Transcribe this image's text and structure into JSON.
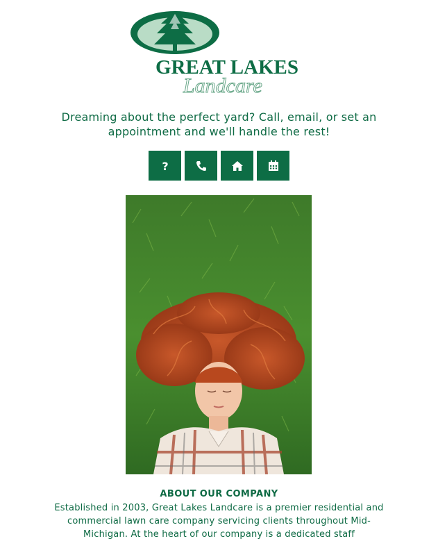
{
  "brand": {
    "name_line1": "GREAT LAKES",
    "name_line2": "Landcare"
  },
  "tagline": "Dreaming about the perfect yard? Call, email, or set an appointment and we'll handle the rest!",
  "buttons": [
    {
      "icon": "question-icon",
      "glyph": "?"
    },
    {
      "icon": "phone-icon"
    },
    {
      "icon": "home-icon"
    },
    {
      "icon": "calendar-icon"
    }
  ],
  "about": {
    "title": "ABOUT OUR COMPANY",
    "text": "Established in 2003, Great Lakes Landcare is a premier residential and commercial lawn care company servicing clients throughout Mid-Michigan. At the heart of our company is a dedicated staff"
  },
  "colors": {
    "brand_green": "#0d6d45",
    "light_green": "#b9dcc6"
  }
}
